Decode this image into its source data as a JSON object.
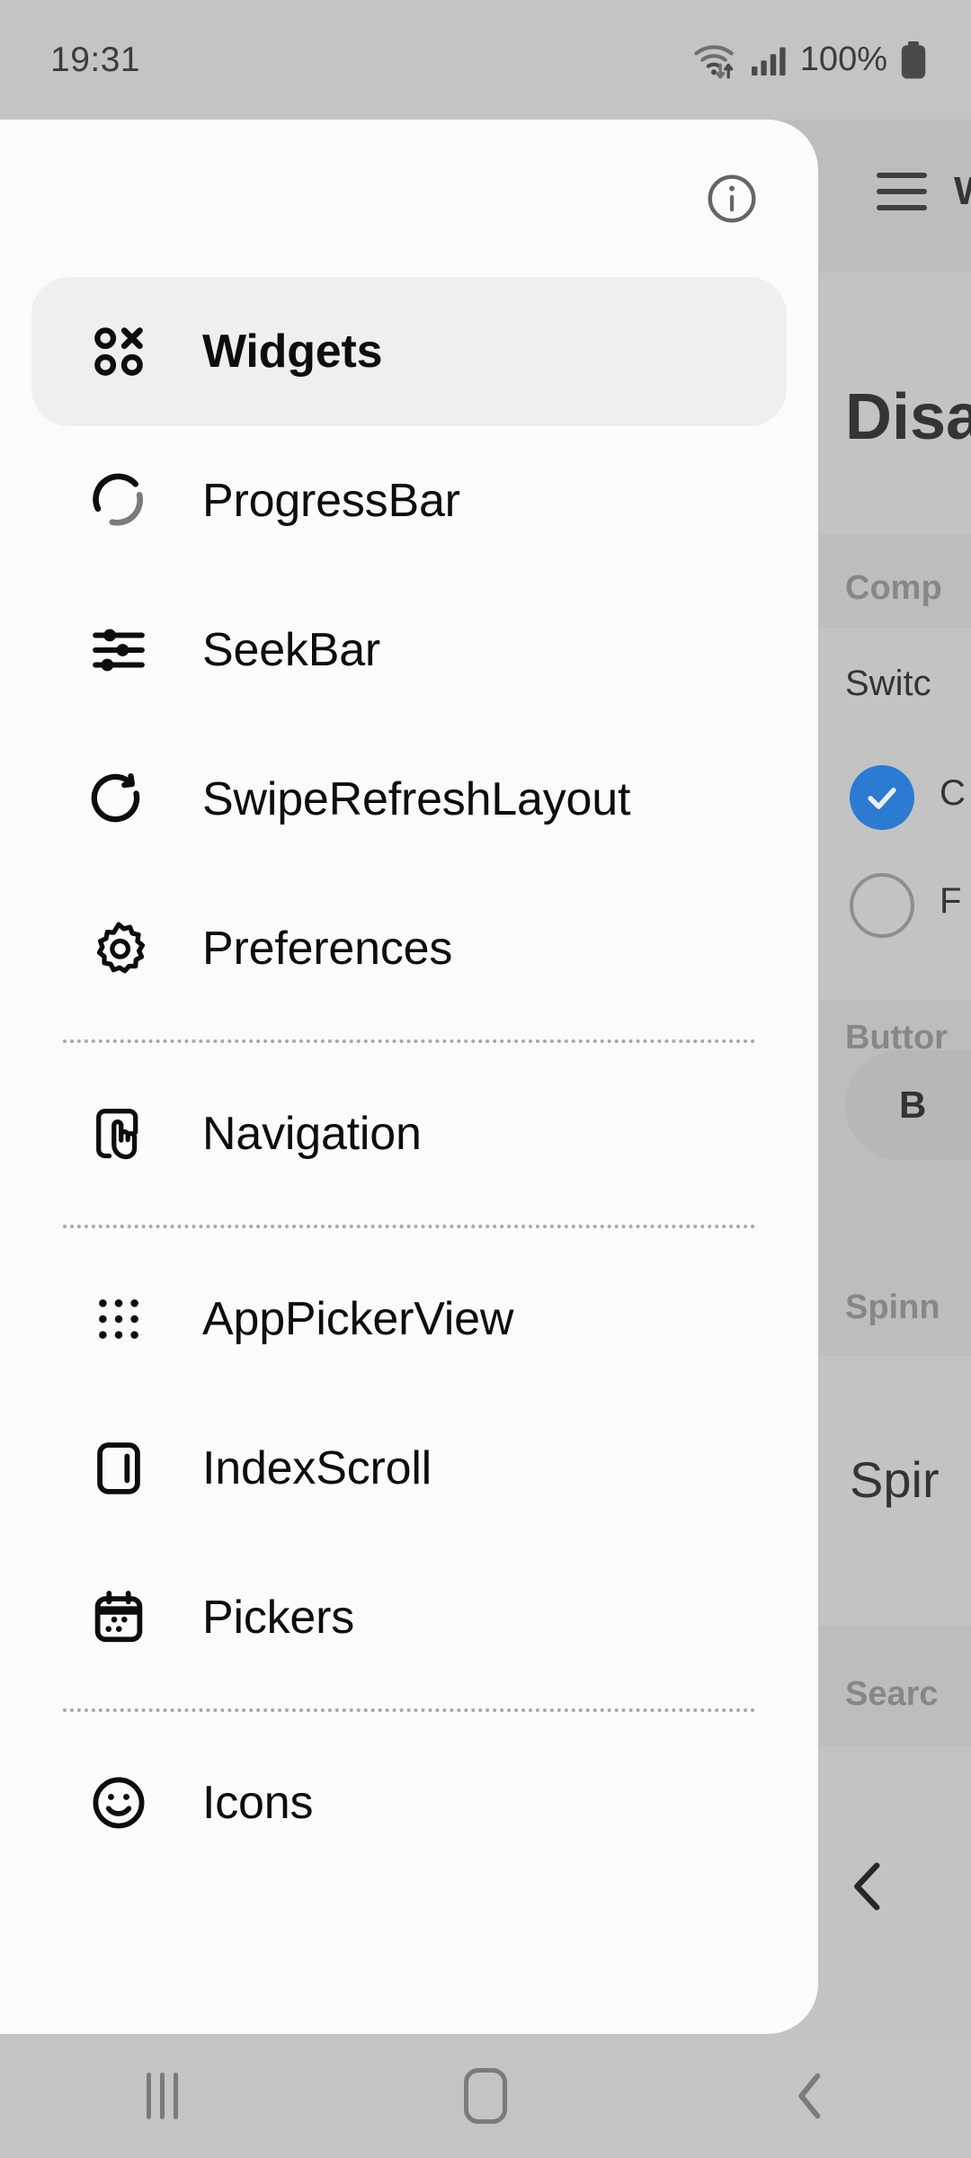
{
  "status_bar": {
    "time": "19:31",
    "battery_percent": "100%",
    "icons": [
      "wifi-icon",
      "signal-icon",
      "battery-icon"
    ]
  },
  "background_app": {
    "hamburger_icon": "hamburger-menu-icon",
    "toolbar_title": "W",
    "heading": "Disa",
    "sections": [
      {
        "label": "Comp",
        "item": "Switc"
      },
      {
        "label": "Buttor",
        "item": "B"
      },
      {
        "label": "Spinn",
        "item": "Spir"
      },
      {
        "label": "Searc",
        "item": ""
      }
    ],
    "checkbox_label": "C",
    "radio_label": "F",
    "back_chevron_icon": "chevron-left-icon"
  },
  "drawer": {
    "info_icon": "info-circle-icon",
    "items": [
      {
        "label": "Widgets",
        "icon": "widgets-grid-icon",
        "selected": true,
        "divider_after": false
      },
      {
        "label": "ProgressBar",
        "icon": "progress-spinner-icon",
        "selected": false,
        "divider_after": false
      },
      {
        "label": "SeekBar",
        "icon": "sliders-icon",
        "selected": false,
        "divider_after": false
      },
      {
        "label": "SwipeRefreshLayout",
        "icon": "refresh-icon",
        "selected": false,
        "divider_after": false
      },
      {
        "label": "Preferences",
        "icon": "gear-icon",
        "selected": false,
        "divider_after": true
      },
      {
        "label": "Navigation",
        "icon": "tap-gesture-icon",
        "selected": false,
        "divider_after": true
      },
      {
        "label": "AppPickerView",
        "icon": "dot-grid-icon",
        "selected": false,
        "divider_after": false
      },
      {
        "label": "IndexScroll",
        "icon": "index-scroll-icon",
        "selected": false,
        "divider_after": false
      },
      {
        "label": "Pickers",
        "icon": "calendar-icon",
        "selected": false,
        "divider_after": true
      },
      {
        "label": "Icons",
        "icon": "smiley-face-icon",
        "selected": false,
        "divider_after": false
      }
    ]
  },
  "system_nav": {
    "recents_icon": "recents-icon",
    "home_icon": "home-icon",
    "back_icon": "back-chevron-icon"
  },
  "colors": {
    "accent_blue": "#1273de",
    "drawer_bg": "#fbfbfb",
    "selected_row_bg": "#efefef",
    "system_bg": "#c4c4c4"
  }
}
